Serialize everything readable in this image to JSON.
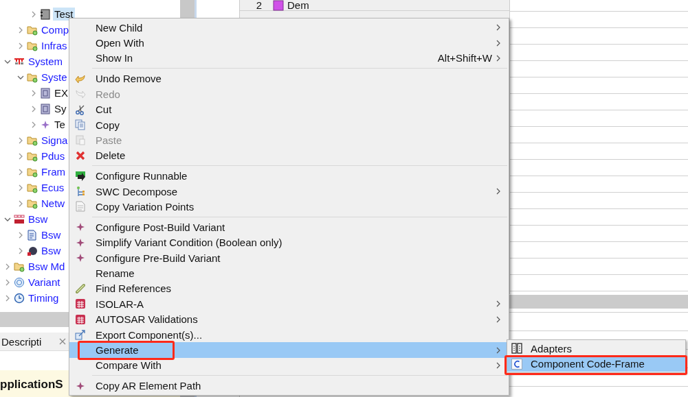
{
  "tree": {
    "items": [
      {
        "children": [
          {
            "children": [
              {
                "label": "Test",
                "kind": "swc",
                "expanded": false,
                "selected": true
              }
            ]
          },
          {
            "label": "Comp",
            "kind": "folder",
            "expanded": false,
            "selected": false
          },
          {
            "label": "Infras",
            "kind": "folder",
            "expanded": false,
            "selected": false
          }
        ]
      },
      {
        "label": "System",
        "kind": "system",
        "expanded": true,
        "selected": false,
        "children": [
          {
            "label": "Syste",
            "kind": "folder",
            "expanded": true,
            "selected": false,
            "children": [
              {
                "label": "EX",
                "kind": "composition",
                "expanded": false,
                "selected": false
              },
              {
                "label": "Sy",
                "kind": "composition",
                "expanded": false,
                "selected": false
              },
              {
                "label": "Te",
                "kind": "diamond",
                "expanded": false,
                "selected": false
              }
            ]
          },
          {
            "label": "Signa",
            "kind": "folder",
            "expanded": false,
            "selected": false
          },
          {
            "label": "Pdus",
            "kind": "folder",
            "expanded": false,
            "selected": false
          },
          {
            "label": "Fram",
            "kind": "folder",
            "expanded": false,
            "selected": false
          },
          {
            "label": "Ecus",
            "kind": "folder",
            "expanded": false,
            "selected": false
          },
          {
            "label": "Netw",
            "kind": "folder",
            "expanded": false,
            "selected": false
          }
        ]
      },
      {
        "label": "Bsw",
        "kind": "bsw",
        "expanded": true,
        "selected": false,
        "children": [
          {
            "label": "Bsw",
            "kind": "bsw-doc",
            "expanded": false,
            "selected": false
          },
          {
            "label": "Bsw",
            "kind": "bsw-disc",
            "expanded": false,
            "selected": false
          }
        ]
      },
      {
        "label": "Bsw Md",
        "kind": "folder",
        "expanded": false,
        "selected": false
      },
      {
        "label": "Variant",
        "kind": "variant",
        "expanded": false,
        "selected": false
      },
      {
        "label": "Timing",
        "kind": "timing",
        "expanded": false,
        "selected": false
      }
    ]
  },
  "bottom_panel": {
    "tab": "Descripti",
    "heading": "pplicationS"
  },
  "table": {
    "rows": [
      {
        "index": "2",
        "name": "Dem"
      }
    ]
  },
  "context_menu": {
    "items": [
      {
        "kind": "text",
        "label": "New Child",
        "disabled": false,
        "submenu": true,
        "selected": false,
        "annotated": false
      },
      {
        "kind": "text",
        "label": "Open With",
        "disabled": false,
        "submenu": true,
        "selected": false,
        "annotated": false
      },
      {
        "kind": "text",
        "label": "Show In",
        "shortcut": "Alt+Shift+W",
        "disabled": false,
        "submenu": true,
        "selected": false,
        "annotated": false
      },
      {
        "kind": "separator"
      },
      {
        "kind": "undo",
        "label": "Undo Remove",
        "disabled": false,
        "submenu": false,
        "selected": false,
        "annotated": false
      },
      {
        "kind": "redo",
        "label": "Redo",
        "disabled": true,
        "submenu": false,
        "selected": false,
        "annotated": false
      },
      {
        "kind": "cut",
        "label": "Cut",
        "disabled": false,
        "submenu": false,
        "selected": false,
        "annotated": false
      },
      {
        "kind": "copy",
        "label": "Copy",
        "disabled": false,
        "submenu": false,
        "selected": false,
        "annotated": false
      },
      {
        "kind": "paste",
        "label": "Paste",
        "disabled": true,
        "submenu": false,
        "selected": false,
        "annotated": false
      },
      {
        "kind": "delete",
        "label": "Delete",
        "disabled": false,
        "submenu": false,
        "selected": false,
        "annotated": false
      },
      {
        "kind": "separator"
      },
      {
        "kind": "runnable",
        "label": "Configure Runnable",
        "disabled": false,
        "submenu": false,
        "selected": false,
        "annotated": false
      },
      {
        "kind": "decompose",
        "label": "SWC Decompose",
        "disabled": false,
        "submenu": true,
        "selected": false,
        "annotated": false
      },
      {
        "kind": "document",
        "label": "Copy Variation Points",
        "disabled": false,
        "submenu": false,
        "selected": false,
        "annotated": false
      },
      {
        "kind": "separator"
      },
      {
        "kind": "variant",
        "label": "Configure Post-Build Variant",
        "disabled": false,
        "submenu": false,
        "selected": false,
        "annotated": false
      },
      {
        "kind": "variant",
        "label": "Simplify Variant Condition (Boolean only)",
        "disabled": false,
        "submenu": false,
        "selected": false,
        "annotated": false
      },
      {
        "kind": "variant",
        "label": "Configure Pre-Build Variant",
        "disabled": false,
        "submenu": false,
        "selected": false,
        "annotated": false
      },
      {
        "kind": "text",
        "label": "Rename",
        "disabled": false,
        "submenu": false,
        "selected": false,
        "annotated": false
      },
      {
        "kind": "references",
        "label": "Find References",
        "disabled": false,
        "submenu": false,
        "selected": false,
        "annotated": false
      },
      {
        "kind": "grid",
        "label": "ISOLAR-A",
        "disabled": false,
        "submenu": true,
        "selected": false,
        "annotated": false
      },
      {
        "kind": "grid",
        "label": "AUTOSAR Validations",
        "disabled": false,
        "submenu": true,
        "selected": false,
        "annotated": false
      },
      {
        "kind": "export",
        "label": "Export Component(s)...",
        "disabled": false,
        "submenu": false,
        "selected": false,
        "annotated": false
      },
      {
        "kind": "text",
        "label": "Generate",
        "disabled": false,
        "submenu": true,
        "selected": true,
        "annotated": true
      },
      {
        "kind": "text",
        "label": "Compare With",
        "disabled": false,
        "submenu": true,
        "selected": false,
        "annotated": false
      },
      {
        "kind": "separator"
      },
      {
        "kind": "variant",
        "label": "Copy AR Element Path",
        "disabled": false,
        "submenu": false,
        "selected": false,
        "annotated": false
      }
    ]
  },
  "submenu": {
    "items": [
      {
        "kind": "adapter",
        "label": "Adapters",
        "selected": false,
        "annotated": false
      },
      {
        "kind": "c-file",
        "label": "Component Code-Frame",
        "selected": true,
        "annotated": true
      }
    ]
  }
}
